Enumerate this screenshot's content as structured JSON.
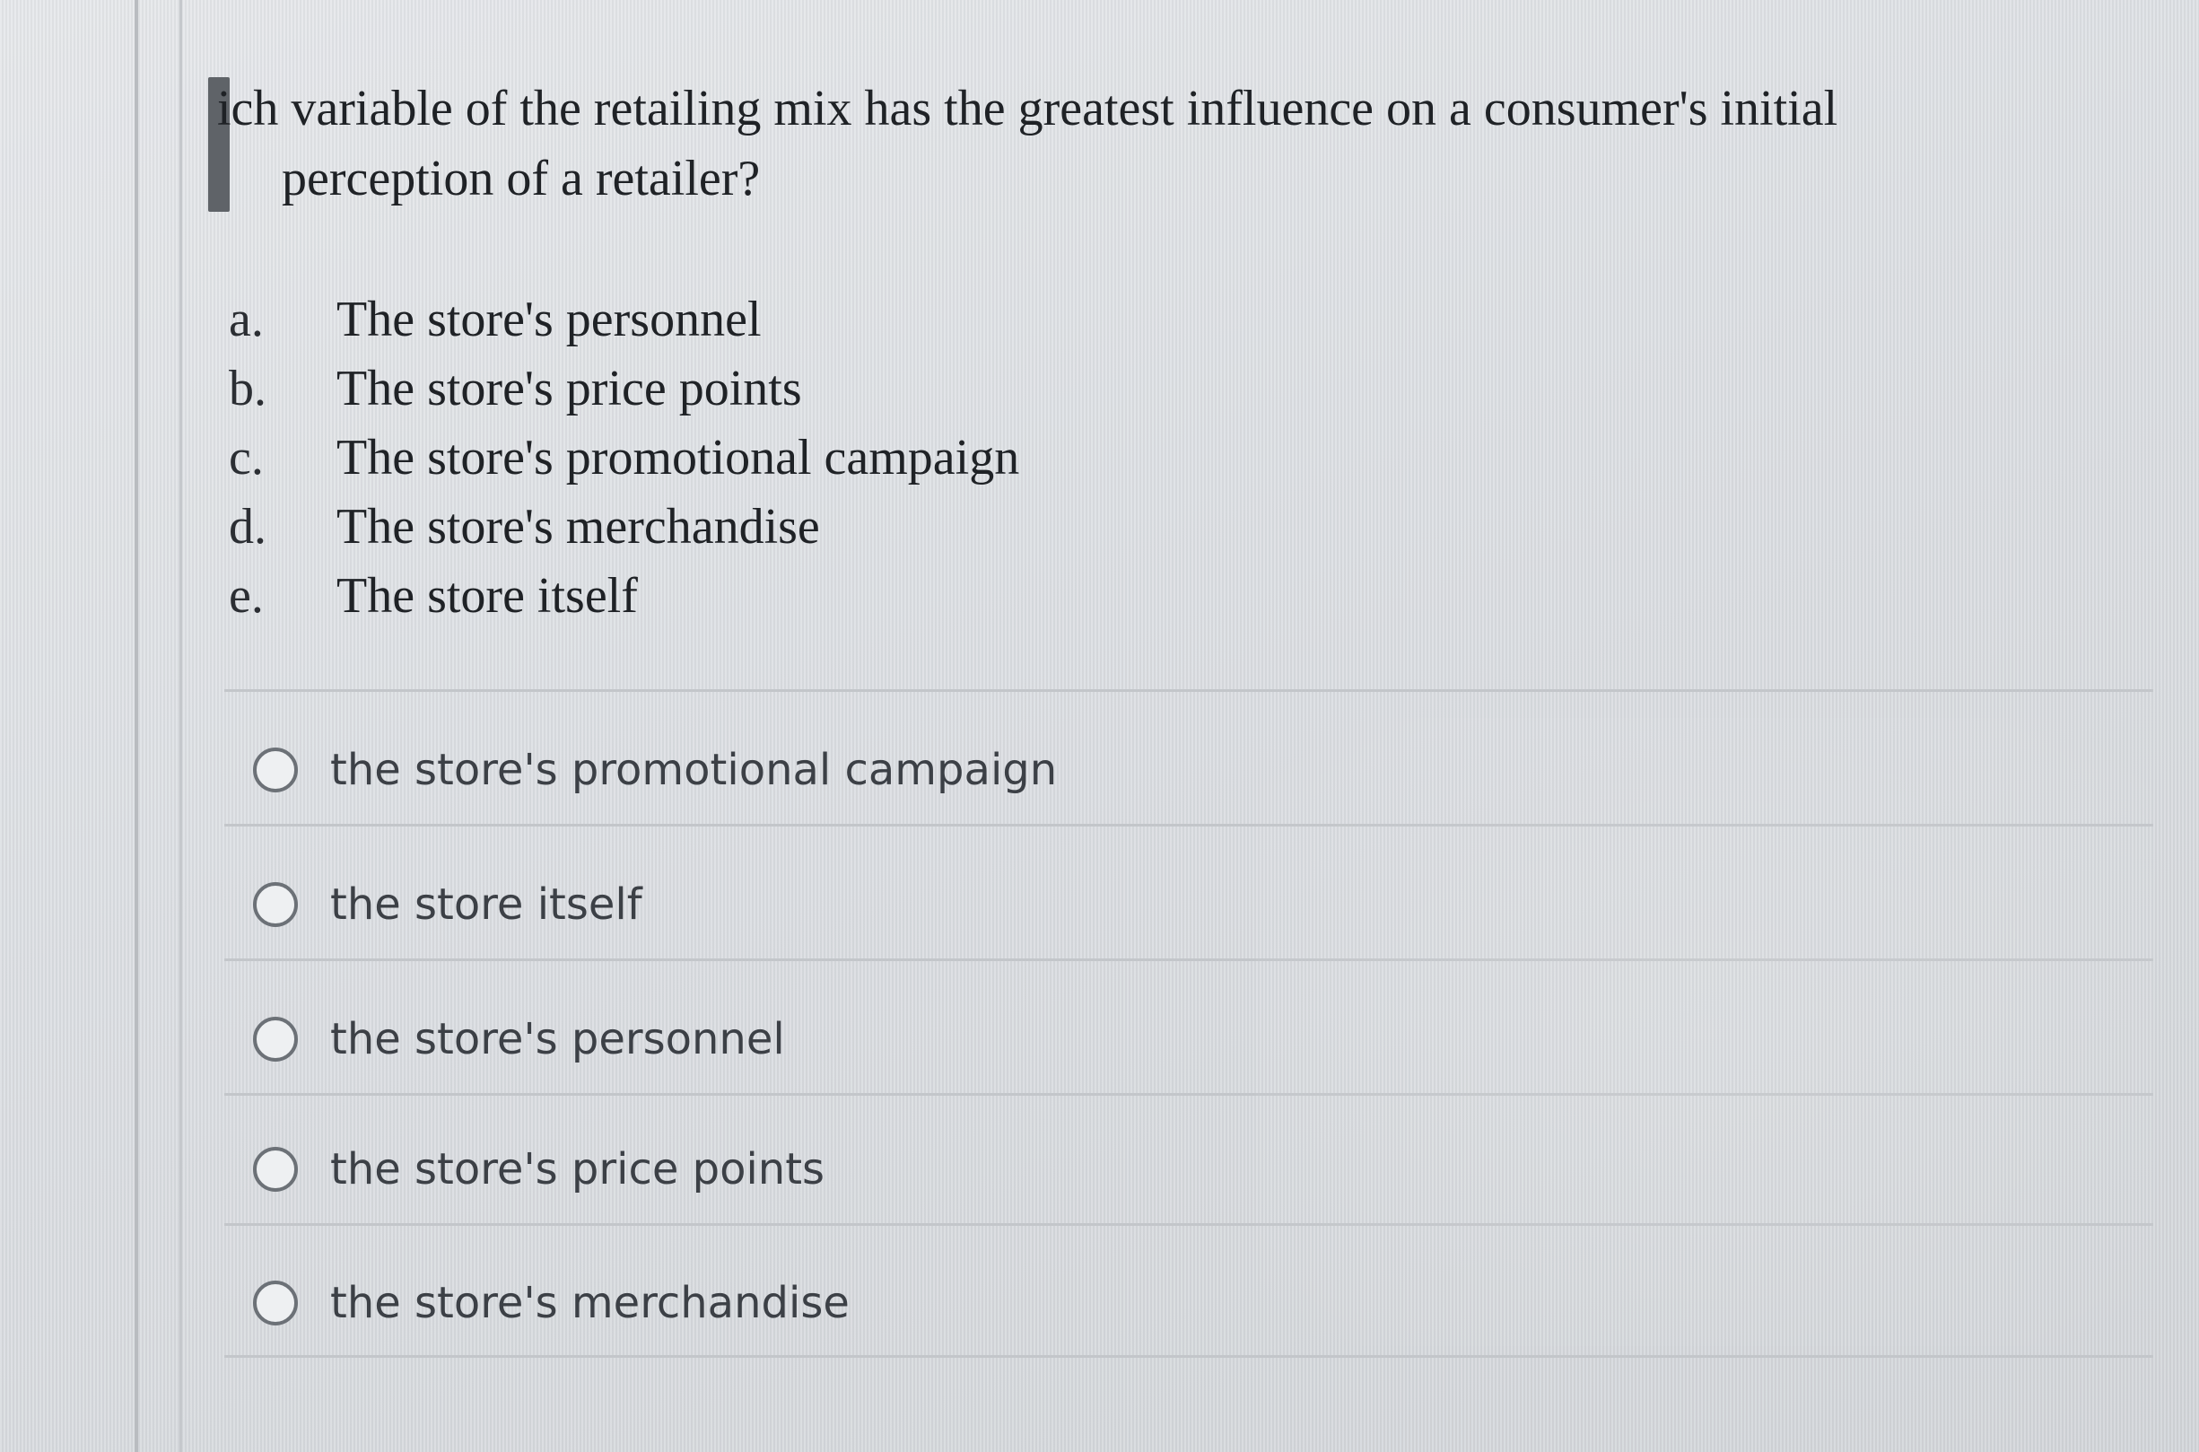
{
  "question": {
    "line1": "ich variable of the retailing mix has the greatest influence on a consumer's initial",
    "line2": "perception of a retailer?"
  },
  "options": [
    {
      "letter": "a.",
      "text": "The store's personnel"
    },
    {
      "letter": "b.",
      "text": "The store's price points"
    },
    {
      "letter": "c.",
      "text": "The store's promotional campaign"
    },
    {
      "letter": "d.",
      "text": "The store's merchandise"
    },
    {
      "letter": "e.",
      "text": "The store itself"
    }
  ],
  "answers": [
    {
      "label": "the store's promotional campaign",
      "selected": false
    },
    {
      "label": "the store itself",
      "selected": false
    },
    {
      "label": "the store's personnel",
      "selected": false
    },
    {
      "label": "the store's price points",
      "selected": false
    },
    {
      "label": "the store's merchandise",
      "selected": false
    }
  ]
}
